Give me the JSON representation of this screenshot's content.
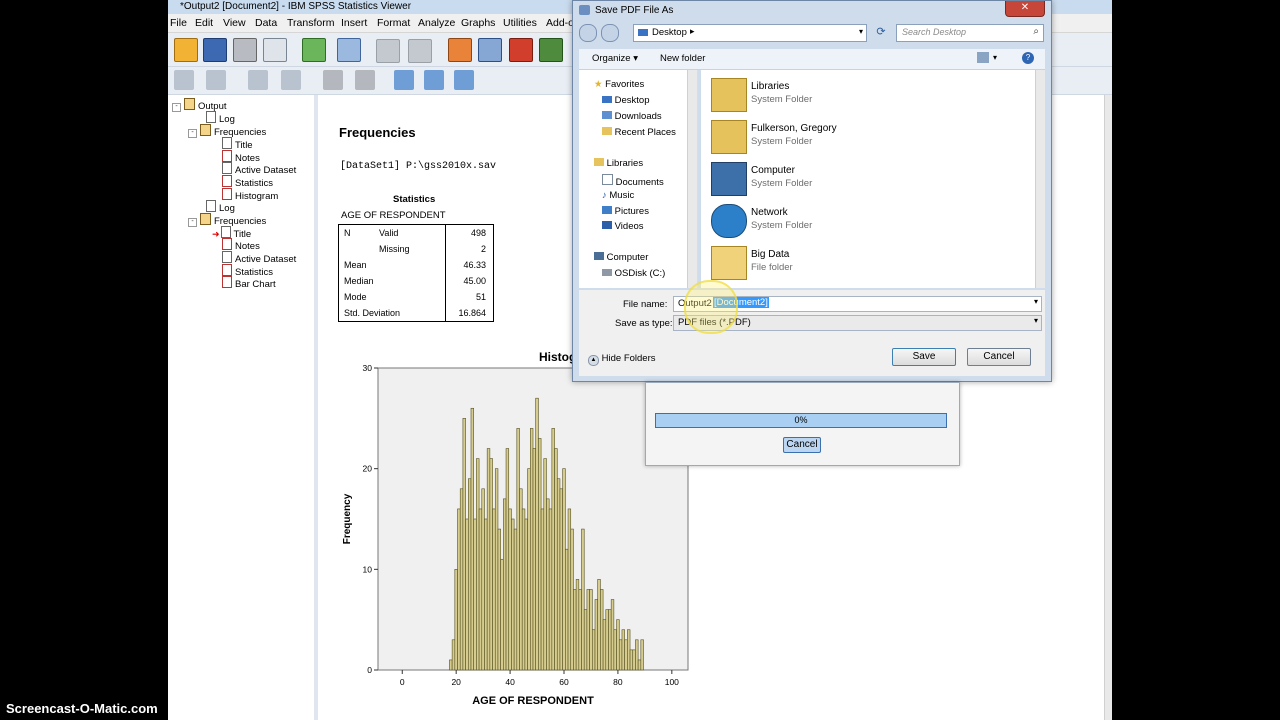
{
  "window": {
    "title": "*Output2 [Document2] - IBM SPSS Statistics Viewer"
  },
  "menu": [
    "File",
    "Edit",
    "View",
    "Data",
    "Transform",
    "Insert",
    "Format",
    "Analyze",
    "Graphs",
    "Utilities",
    "Add-o"
  ],
  "nav_tree": {
    "items": [
      {
        "label": "Output",
        "icon": "output-icon"
      },
      {
        "label": "Log",
        "icon": "log-icon"
      },
      {
        "label": "Frequencies",
        "icon": "frequencies-icon"
      },
      {
        "label": "Title",
        "icon": "page-icon"
      },
      {
        "label": "Notes",
        "icon": "notes-icon"
      },
      {
        "label": "Active Dataset",
        "icon": "page-icon"
      },
      {
        "label": "Statistics",
        "icon": "table-icon"
      },
      {
        "label": "Histogram",
        "icon": "chart-icon"
      },
      {
        "label": "Log",
        "icon": "log-icon"
      },
      {
        "label": "Frequencies",
        "icon": "frequencies-icon"
      },
      {
        "label": "Title",
        "icon": "page-icon"
      },
      {
        "label": "Notes",
        "icon": "notes-icon"
      },
      {
        "label": "Active Dataset",
        "icon": "page-icon"
      },
      {
        "label": "Statistics",
        "icon": "table-icon"
      },
      {
        "label": "Bar Chart",
        "icon": "chart-icon"
      }
    ]
  },
  "output": {
    "heading": "Frequencies",
    "dataset": "[DataSet1] P:\\gss2010x.sav",
    "stats_title": "Statistics",
    "stats_subtitle": "AGE OF RESPONDENT",
    "stats": {
      "n_label": "N",
      "valid_label": "Valid",
      "valid": "498",
      "missing_label": "Missing",
      "missing": "2",
      "mean_label": "Mean",
      "mean": "46.33",
      "median_label": "Median",
      "median": "45.00",
      "mode_label": "Mode",
      "mode": "51",
      "sd_label": "Std. Deviation",
      "sd": "16.864"
    },
    "hist_title": "Histog"
  },
  "dialog": {
    "title": "Save PDF File As",
    "location": "Desktop",
    "search_placeholder": "Search Desktop",
    "organize": "Organize",
    "new_folder": "New folder",
    "nav": {
      "favorites": "Favorites",
      "fav_items": [
        "Desktop",
        "Downloads",
        "Recent Places"
      ],
      "libraries": "Libraries",
      "lib_items": [
        "Documents",
        "Music",
        "Pictures",
        "Videos"
      ],
      "computer": "Computer",
      "comp_items": [
        "OSDisk (C:)"
      ]
    },
    "files": [
      {
        "name": "Libraries",
        "type": "System Folder"
      },
      {
        "name": "Fulkerson, Gregory",
        "type": "System Folder"
      },
      {
        "name": "Computer",
        "type": "System Folder"
      },
      {
        "name": "Network",
        "type": "System Folder"
      },
      {
        "name": "Big Data",
        "type": "File folder"
      }
    ],
    "file_name_label": "File name:",
    "file_name_prefix": "Output2",
    "file_name_selected": "[Document2]",
    "save_type_label": "Save as type:",
    "save_type": "PDF files (*.PDF)",
    "hide_folders": "Hide Folders",
    "save": "Save",
    "cancel": "Cancel"
  },
  "progress": {
    "percent_text": "0%",
    "value": 0,
    "cancel": "Cancel"
  },
  "watermark": "Screencast-O-Matic.com",
  "colors": {
    "bar_fill": "#d6cc8f",
    "bar_stroke": "#55501f",
    "plot_bg": "#f0f0f0",
    "title_bar": "#c9dbee"
  },
  "chart_data": {
    "type": "bar",
    "xlabel": "AGE OF RESPONDENT",
    "ylabel": "Frequency",
    "xlim": [
      -9,
      106
    ],
    "ylim": [
      0,
      30
    ],
    "x_ticks": [
      0,
      20,
      40,
      60,
      80,
      100
    ],
    "y_ticks": [
      0,
      10,
      20,
      30
    ],
    "bin_width": 1,
    "x": [
      18,
      19,
      20,
      21,
      22,
      23,
      24,
      25,
      26,
      27,
      28,
      29,
      30,
      31,
      32,
      33,
      34,
      35,
      36,
      37,
      38,
      39,
      40,
      41,
      42,
      43,
      44,
      45,
      46,
      47,
      48,
      49,
      50,
      51,
      52,
      53,
      54,
      55,
      56,
      57,
      58,
      59,
      60,
      61,
      62,
      63,
      64,
      65,
      66,
      67,
      68,
      69,
      70,
      71,
      72,
      73,
      74,
      75,
      76,
      77,
      78,
      79,
      80,
      81,
      82,
      83,
      84,
      85,
      86,
      87,
      88,
      89
    ],
    "values": [
      1,
      3,
      10,
      16,
      18,
      25,
      15,
      19,
      26,
      15,
      21,
      16,
      18,
      15,
      22,
      21,
      16,
      20,
      14,
      11,
      17,
      22,
      16,
      15,
      14,
      24,
      18,
      16,
      15,
      20,
      24,
      22,
      27,
      23,
      16,
      21,
      17,
      16,
      24,
      22,
      19,
      18,
      20,
      12,
      16,
      14,
      8,
      9,
      8,
      14,
      6,
      8,
      8,
      4,
      7,
      9,
      8,
      5,
      6,
      6,
      7,
      4,
      5,
      3,
      4,
      3,
      4,
      2,
      2,
      3,
      1,
      3
    ]
  }
}
